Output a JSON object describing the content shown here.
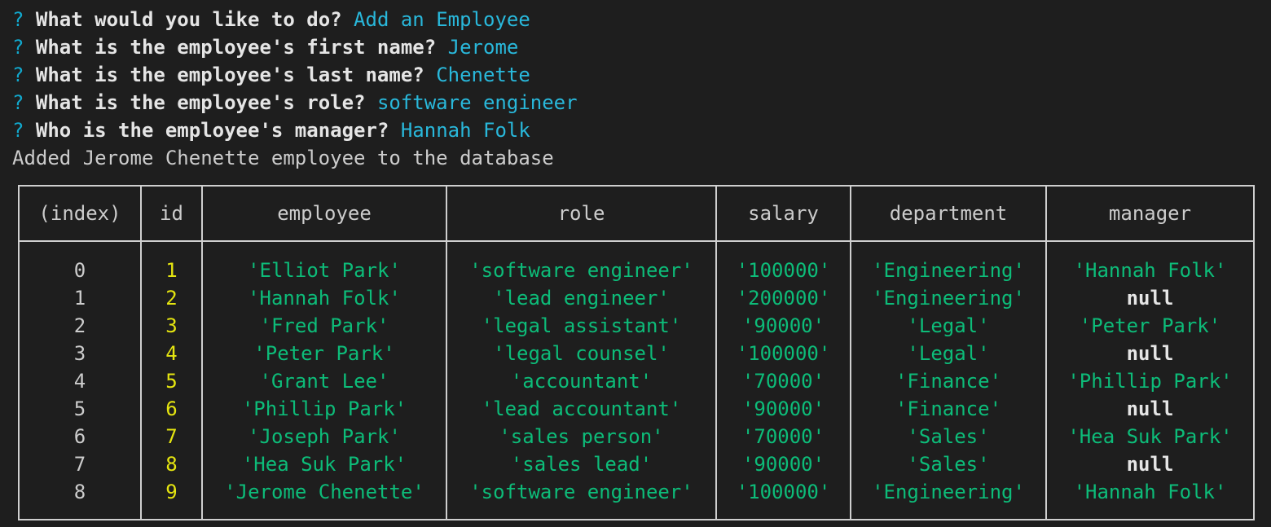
{
  "prompts": [
    {
      "marker": "?",
      "question": "What would you like to do?",
      "answer": "Add an Employee"
    },
    {
      "marker": "?",
      "question": "What is the employee's first name?",
      "answer": "Jerome"
    },
    {
      "marker": "?",
      "question": "What is the employee's last name?",
      "answer": "Chenette"
    },
    {
      "marker": "?",
      "question": "What is the employee's role?",
      "answer": "software engineer"
    },
    {
      "marker": "?",
      "question": "Who is the employee's manager?",
      "answer": "Hannah Folk"
    }
  ],
  "message": "Added Jerome Chenette employee to the database",
  "table": {
    "headers": [
      "(index)",
      "id",
      "employee",
      "role",
      "salary",
      "department",
      "manager"
    ],
    "rows": [
      {
        "index": "0",
        "id": "1",
        "employee": "'Elliot Park'",
        "role": "'software engineer'",
        "salary": "'100000'",
        "department": "'Engineering'",
        "manager": "'Hannah Folk'"
      },
      {
        "index": "1",
        "id": "2",
        "employee": "'Hannah Folk'",
        "role": "'lead engineer'",
        "salary": "'200000'",
        "department": "'Engineering'",
        "manager": "null"
      },
      {
        "index": "2",
        "id": "3",
        "employee": "'Fred Park'",
        "role": "'legal assistant'",
        "salary": "'90000'",
        "department": "'Legal'",
        "manager": "'Peter Park'"
      },
      {
        "index": "3",
        "id": "4",
        "employee": "'Peter Park'",
        "role": "'legal counsel'",
        "salary": "'100000'",
        "department": "'Legal'",
        "manager": "null"
      },
      {
        "index": "4",
        "id": "5",
        "employee": "'Grant Lee'",
        "role": "'accountant'",
        "salary": "'70000'",
        "department": "'Finance'",
        "manager": "'Phillip Park'"
      },
      {
        "index": "5",
        "id": "6",
        "employee": "'Phillip Park'",
        "role": "'lead accountant'",
        "salary": "'90000'",
        "department": "'Finance'",
        "manager": "null"
      },
      {
        "index": "6",
        "id": "7",
        "employee": "'Joseph Park'",
        "role": "'sales person'",
        "salary": "'70000'",
        "department": "'Sales'",
        "manager": "'Hea Suk Park'"
      },
      {
        "index": "7",
        "id": "8",
        "employee": "'Hea Suk Park'",
        "role": "'sales lead'",
        "salary": "'90000'",
        "department": "'Sales'",
        "manager": "null"
      },
      {
        "index": "8",
        "id": "9",
        "employee": "'Jerome Chenette'",
        "role": "'software engineer'",
        "salary": "'100000'",
        "department": "'Engineering'",
        "manager": "'Hannah Folk'"
      }
    ]
  },
  "colors": {
    "background": "#1e1e1e",
    "question_marker": "#11a8cd",
    "answer": "#29b8db",
    "string_value": "#0dbc79",
    "number_value": "#e5e510",
    "null_value": "#e5e5e5"
  }
}
